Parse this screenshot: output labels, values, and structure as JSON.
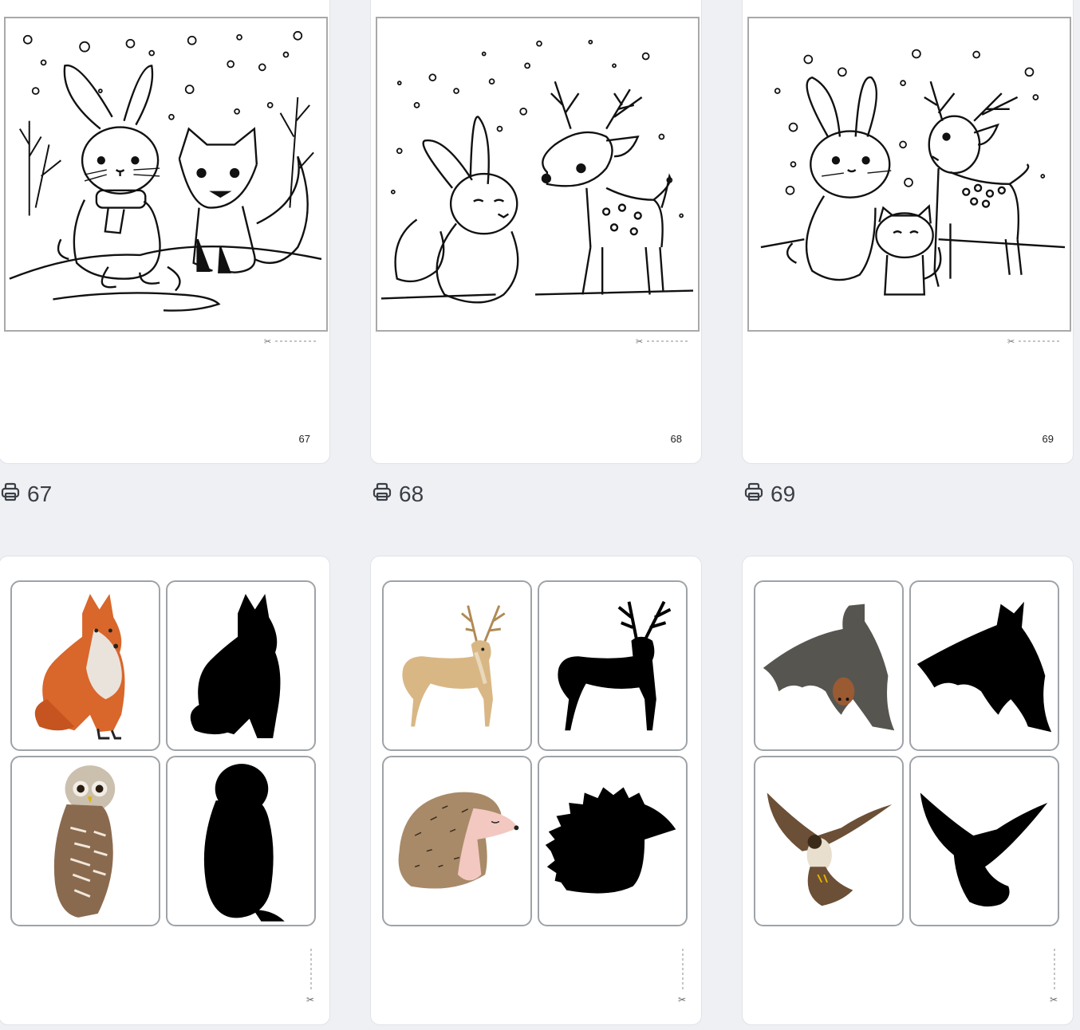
{
  "pages": [
    {
      "page_number": "67",
      "print_label": "67",
      "icon": "printer-icon",
      "type": "coloring",
      "scene": "bunny-and-fox"
    },
    {
      "page_number": "68",
      "print_label": "68",
      "icon": "printer-icon",
      "type": "coloring",
      "scene": "bunny-and-deer"
    },
    {
      "page_number": "69",
      "print_label": "69",
      "icon": "printer-icon",
      "type": "coloring",
      "scene": "bunny-kitten-deer"
    }
  ],
  "matching_sheets": [
    {
      "icon": "scissors-icon",
      "tiles": [
        {
          "animal": "fox",
          "style": "color",
          "color": "#d9662a"
        },
        {
          "animal": "fox",
          "style": "silhouette",
          "color": "#000000"
        },
        {
          "animal": "owl",
          "style": "color",
          "color": "#8a6a4e"
        },
        {
          "animal": "owl",
          "style": "silhouette",
          "color": "#000000"
        }
      ]
    },
    {
      "icon": "scissors-icon",
      "tiles": [
        {
          "animal": "deer",
          "style": "color",
          "color": "#d9b785"
        },
        {
          "animal": "deer",
          "style": "silhouette",
          "color": "#000000"
        },
        {
          "animal": "hedgehog",
          "style": "color",
          "color": "#a88a69"
        },
        {
          "animal": "hedgehog",
          "style": "silhouette",
          "color": "#000000"
        }
      ]
    },
    {
      "icon": "scissors-icon",
      "tiles": [
        {
          "animal": "bat",
          "style": "color",
          "color": "#575550"
        },
        {
          "animal": "bat",
          "style": "silhouette",
          "color": "#000000"
        },
        {
          "animal": "bird",
          "style": "color",
          "color": "#6b4f36"
        },
        {
          "animal": "bird",
          "style": "silhouette",
          "color": "#000000"
        }
      ]
    }
  ]
}
